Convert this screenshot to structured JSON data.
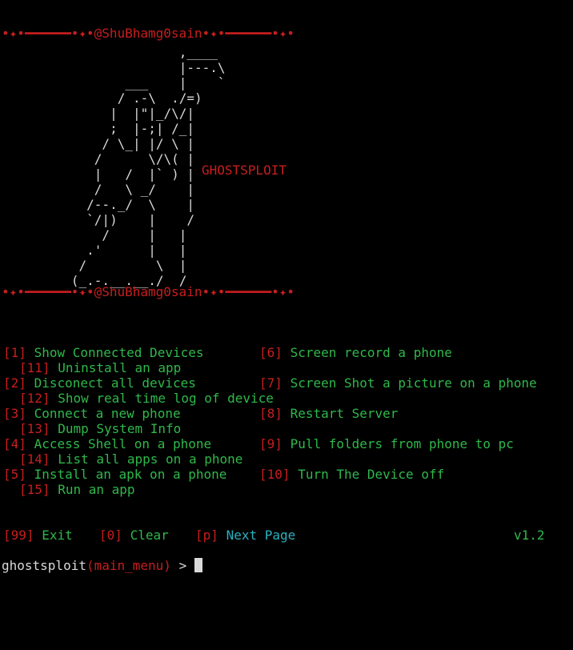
{
  "banner": {
    "deco_left": "•✦•━━━━━━•✦•",
    "author": "@ShuBhamg0sain",
    "deco_right": "•✦•━━━━━━•✦•"
  },
  "ascii_art": "                 ,____\n                 |---.\\\n          ___    |    `\n         / .-\\  ./=)\n        |  |\"|_/\\/|\n        ;  |-;| /_|\n       / \\_| |/ \\ |\n      /      \\/\\( |\n      |   /  |` ) |\n      /   \\ _/    |\n     /--._/  \\    |\n     `/|)    |    /\n       /     |   |\n     .'      |   |\n    /         \\  |\n   (_.-.__.__./  /",
  "logo_text": "GHOSTSPLOIT",
  "menu": {
    "items": [
      {
        "num": "1",
        "label": "Show Connected Devices"
      },
      {
        "num": "11",
        "label": "Uninstall an app"
      },
      {
        "num": "2",
        "label": "Disconect all devices"
      },
      {
        "num": "12",
        "label": "Show real time log of device"
      },
      {
        "num": "3",
        "label": "Connect a new phone"
      },
      {
        "num": "13",
        "label": "Dump System Info"
      },
      {
        "num": "4",
        "label": "Access Shell on a phone"
      },
      {
        "num": "14",
        "label": "List all apps on a phone"
      },
      {
        "num": "5",
        "label": "Install an apk on a phone"
      },
      {
        "num": "15",
        "label": "Run an app"
      },
      {
        "num": "6",
        "label": "Screen record a phone"
      },
      {
        "num": "7",
        "label": "Screen Shot a picture on a phone"
      },
      {
        "num": "8",
        "label": "Restart Server"
      },
      {
        "num": "9",
        "label": "Pull folders from phone to pc"
      },
      {
        "num": "10",
        "label": "Turn The Device off"
      }
    ]
  },
  "footer": {
    "exit": {
      "num": "99",
      "label": "Exit"
    },
    "clear": {
      "num": "0",
      "label": "Clear"
    },
    "next": {
      "num": "p",
      "label": "Next Page"
    },
    "version": "v1.2"
  },
  "prompt": {
    "app": "ghostsploit",
    "context": "main_menu",
    "symbol": " > "
  },
  "colors": {
    "bracket": "#c81e1e",
    "menu_label": "#2fb84a",
    "next_page": "#2bb0bf",
    "text": "#d9d9d9",
    "background": "#000000"
  }
}
